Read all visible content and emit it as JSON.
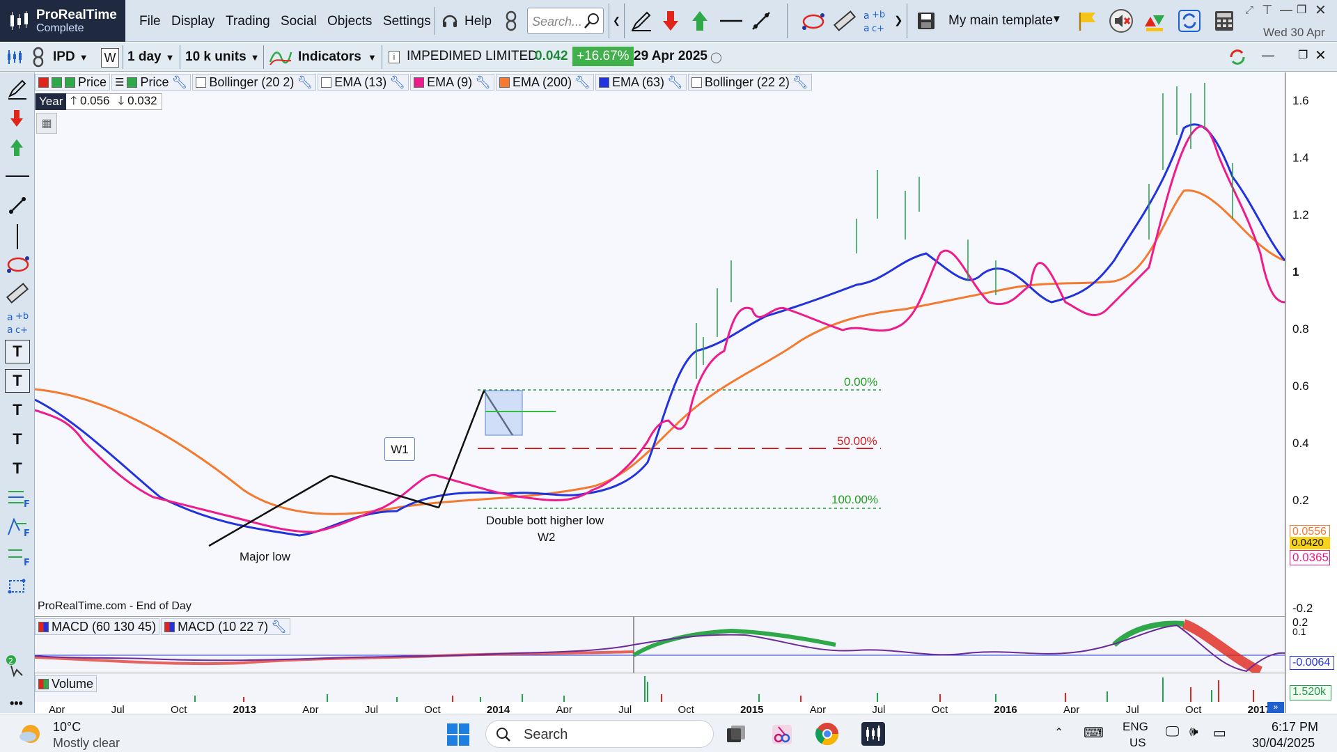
{
  "app": {
    "name": "ProRealTime",
    "edition": "Complete"
  },
  "menu": [
    "File",
    "Display",
    "Trading",
    "Social",
    "Objects",
    "Settings"
  ],
  "help_label": "Help",
  "search": {
    "placeholder": "Search..."
  },
  "template": {
    "label": "My main template"
  },
  "date_top": "Wed 30 Apr",
  "toolbar2": {
    "ticker": "IPD",
    "period_w": "W",
    "interval": "1 day",
    "units": "10 k units",
    "indicators": "Indicators",
    "instrument": "IMPEDIMED LIMITED",
    "price": "0.042",
    "change": "+16.67%",
    "date": "29 Apr 2025"
  },
  "legend": [
    {
      "label": "Price",
      "color": "#22a04a"
    },
    {
      "label": "Price",
      "color": "#22a04a"
    },
    {
      "label": "Bollinger (20 2)",
      "color": "#ffffff"
    },
    {
      "label": "EMA (13)",
      "color": "#ffffff"
    },
    {
      "label": "EMA (9)",
      "color": "#ee1b8c"
    },
    {
      "label": "EMA (200)",
      "color": "#f47a30"
    },
    {
      "label": "EMA (63)",
      "color": "#2233dd"
    },
    {
      "label": "Bollinger (22 2)",
      "color": "#ffffff"
    }
  ],
  "year_box": {
    "label": "Year",
    "up": "0.056",
    "down": "0.032"
  },
  "fib": [
    {
      "label": "0.00%",
      "color": "#22a020"
    },
    {
      "label": "50.00%",
      "color": "#d02020"
    },
    {
      "label": "100.00%",
      "color": "#22a020"
    }
  ],
  "annotations": {
    "w1": "W1",
    "major_low": "Major low",
    "double_bott": "Double bott higher low",
    "w2": "W2"
  },
  "price_axis": [
    "1.6",
    "1.4",
    "1.2",
    "1",
    "0.8",
    "0.6",
    "0.4",
    "0.2",
    "-0.2"
  ],
  "price_tags": [
    {
      "label": "0.0556",
      "color": "#f47a30"
    },
    {
      "label": "0.0420",
      "color": "#111111"
    },
    {
      "label": "0.0365",
      "color": "#ee1b8c"
    }
  ],
  "source_note": "ProRealTime.com - End of Day",
  "macd_legend": [
    "MACD (60 130 45)",
    "MACD (10 22 7)"
  ],
  "macd_axis": [
    "0.2",
    "0.1",
    "-0.0064"
  ],
  "volume_legend": "Volume",
  "volume_axis": "1.520k",
  "time_axis": [
    "Apr",
    "Jul",
    "Oct",
    "2013",
    "Apr",
    "Jul",
    "Oct",
    "2014",
    "Apr",
    "Jul",
    "Oct",
    "2015",
    "Apr",
    "Jul",
    "Oct",
    "2016",
    "Apr",
    "Jul",
    "Oct",
    "2017"
  ],
  "taskbar": {
    "weather_temp": "10°C",
    "weather_desc": "Mostly clear",
    "search": "Search",
    "lang": "ENG",
    "region": "US",
    "time": "6:17 PM",
    "date": "30/04/2025"
  },
  "colors": {
    "ema9": "#ee1b8c",
    "ema63": "#2233dd",
    "ema200": "#f47a30",
    "price": "#22a04a"
  }
}
